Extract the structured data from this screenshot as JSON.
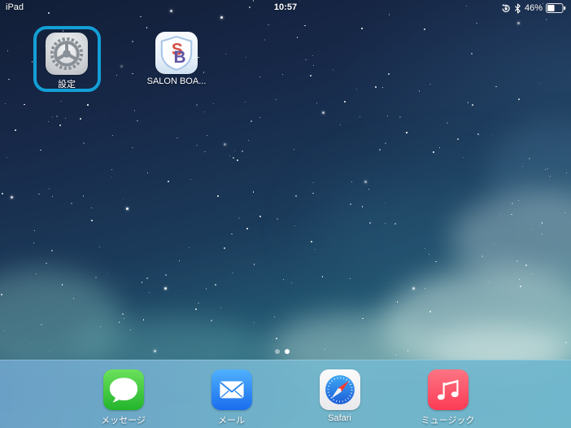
{
  "status_bar": {
    "carrier": "iPad",
    "time": "10:57",
    "battery_percent": "46%",
    "icons": [
      "orientation-lock-icon",
      "bluetooth-icon",
      "battery-icon"
    ]
  },
  "home_screen": {
    "apps": [
      {
        "name": "settings",
        "label": "設定",
        "selected": true
      },
      {
        "name": "salon-board",
        "label": "SALON BOA..."
      }
    ],
    "selection_highlight_color": "#129fd6",
    "page_dots": {
      "count": 2,
      "active_index": 1
    }
  },
  "dock": {
    "apps": [
      {
        "name": "messages",
        "label": "メッセージ",
        "color": "#34c53a"
      },
      {
        "name": "mail",
        "label": "メール",
        "color": "#2b87f0"
      },
      {
        "name": "safari",
        "label": "Safari",
        "color": "#2377ee"
      },
      {
        "name": "music",
        "label": "ミュージック",
        "color": "#fb3b56"
      }
    ]
  },
  "wallpaper": {
    "style": "ios7-blue-nebula-starfield",
    "top_color": "#121e37",
    "bottom_color": "#3a8f9a"
  }
}
